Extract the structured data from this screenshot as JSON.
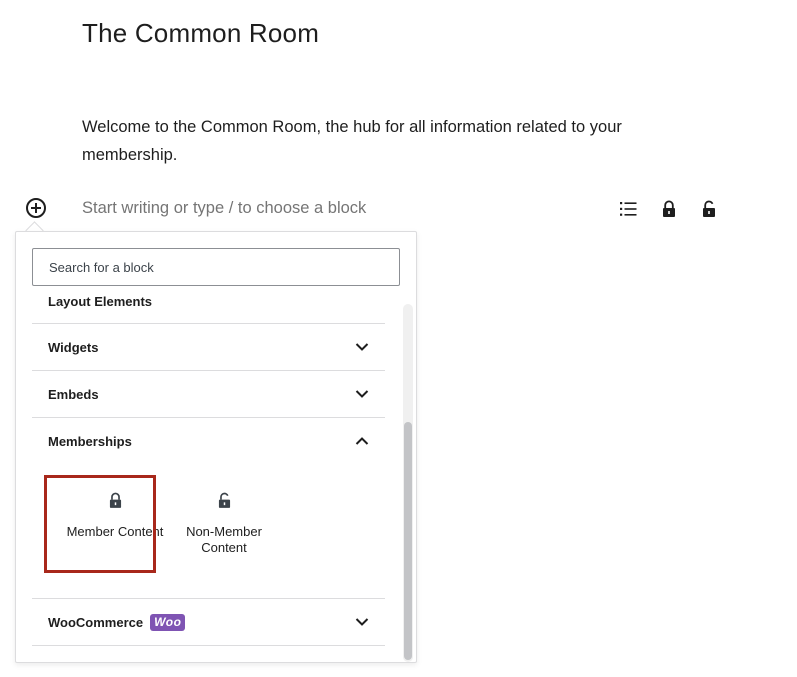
{
  "page": {
    "title": "The Common Room",
    "paragraph": "Welcome to the Common Room, the hub for all information related to your membership.",
    "placeholder": "Start writing or type / to choose a block"
  },
  "toolbar": {
    "icons": [
      "list-icon",
      "lock-icon",
      "unlock-icon"
    ]
  },
  "inserter": {
    "search_placeholder": "Search for a block",
    "cut_category": "Layout Elements",
    "categories": [
      {
        "label": "Widgets",
        "state": "collapsed"
      },
      {
        "label": "Embeds",
        "state": "collapsed"
      },
      {
        "label": "Memberships",
        "state": "expanded"
      },
      {
        "label": "WooCommerce",
        "state": "collapsed",
        "badge": "Woo"
      }
    ],
    "membership_blocks": [
      {
        "label": "Member Content",
        "icon": "lock-icon",
        "highlighted": true
      },
      {
        "label": "Non-Member Content",
        "icon": "lock-icon",
        "highlighted": false
      }
    ]
  },
  "colors": {
    "highlight_border": "#a8281b",
    "woo_purple": "#7f54b3"
  }
}
